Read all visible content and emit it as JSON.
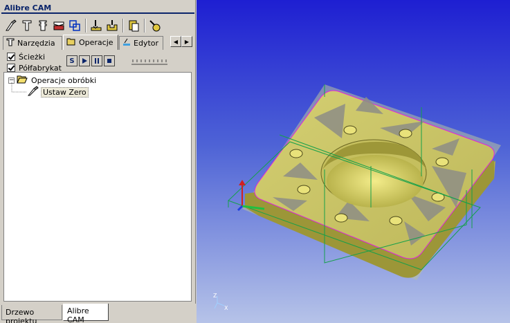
{
  "app": {
    "title": "Alibre CAM"
  },
  "toolbar": {
    "icons": [
      "cutter-path-icon",
      "tool-icon",
      "tool-holder-icon",
      "stock-icon",
      "copy-icon",
      "drill-icon",
      "pocket-icon",
      "clipboard-icon",
      "simulate-icon"
    ]
  },
  "tabs": [
    {
      "label": "Narzędzia"
    },
    {
      "label": "Operacje"
    },
    {
      "label": "Edytor"
    }
  ],
  "options": {
    "paths_label": "Ścieżki",
    "semi_label": "Półfabrykat",
    "paths_checked": true,
    "semi_checked": true
  },
  "playback": {
    "s_label": "S",
    "play_icon": "play-icon",
    "pause_icon": "pause-icon",
    "stop_icon": "stop-icon"
  },
  "tree": {
    "root_label": "Operacje obróbki",
    "root_expander": "−",
    "child_label": "Ustaw Zero"
  },
  "bottom_tabs": [
    {
      "label": "Drzewo projektu"
    },
    {
      "label": "Alibre CAM"
    }
  ],
  "viewport": {
    "axis_labels": {
      "z": "Z",
      "x": "X"
    },
    "colors": {
      "part": "#c9c467",
      "part_dark": "#8f8a2f",
      "hole": "#e9e27a",
      "toolpath": "#15a04a",
      "edge": "#e020e0"
    }
  }
}
